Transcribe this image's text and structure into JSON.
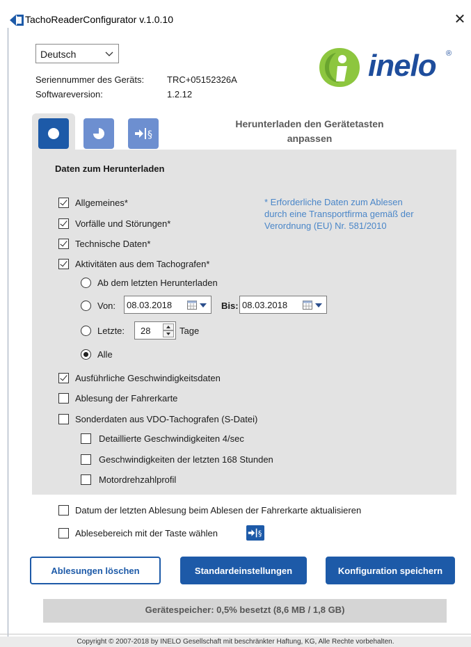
{
  "window": {
    "title": "TachoReaderConfigurator v.1.0.10",
    "close_glyph": "✕"
  },
  "language": {
    "selected": "Deutsch"
  },
  "device": {
    "serial_label": "Seriennummer des Geräts:",
    "serial_value": "TRC+05152326A",
    "software_label": "Softwareversion:",
    "software_value": "1.2.12"
  },
  "logo": {
    "text": "inelo",
    "reg": "®",
    "brand_color": "#1e4d9c",
    "accent_color": "#8dc63f"
  },
  "tabs": {
    "items": [
      {
        "icon": "circle-icon",
        "active": true
      },
      {
        "icon": "pie-chart-icon",
        "active": false
      },
      {
        "icon": "arrow-section-icon",
        "active": false
      }
    ],
    "caption_line1": "Herunterladen den Gerätetasten",
    "caption_line2": "anpassen"
  },
  "panel": {
    "title": "Daten zum Herunterladen",
    "note_line1": "* Erforderliche Daten zum Ablesen",
    "note_line2": "durch eine Transportfirma gemäß der",
    "note_line3": "Verordnung (EU) Nr. 581/2010",
    "options": {
      "allgemeines": {
        "label": "Allgemeines*",
        "checked": true
      },
      "vorfaelle": {
        "label": "Vorfälle und Störungen*",
        "checked": true
      },
      "technische": {
        "label": "Technische Daten*",
        "checked": true
      },
      "aktivitaeten": {
        "label": "Aktivitäten aus dem Tachografen*",
        "checked": true
      },
      "geschwindigkeit": {
        "label": "Ausführliche Geschwindigkeitsdaten",
        "checked": true
      },
      "fahrerkarte": {
        "label": "Ablesung der Fahrerkarte",
        "checked": false
      },
      "sonderdaten": {
        "label": "Sonderdaten aus VDO-Tachografen (S-Datei)",
        "checked": false
      },
      "detailliert": {
        "label": "Detaillierte Geschwindigkeiten 4/sec",
        "checked": false
      },
      "letzte168": {
        "label": "Geschwindigkeiten der letzten 168 Stunden",
        "checked": false
      },
      "motordrehzahl": {
        "label": "Motordrehzahlprofil",
        "checked": false
      }
    },
    "range": {
      "since_last": "Ab dem letzten Herunterladen",
      "von_label": "Von:",
      "von_value": "08.03.2018",
      "bis_label": "Bis:",
      "bis_value": "08.03.2018",
      "letzte_label": "Letzte:",
      "letzte_value": "28",
      "tage_label": "Tage",
      "alle_label": "Alle",
      "selected": "alle"
    }
  },
  "bottom_options": {
    "update_date": {
      "label": "Datum der letzten Ablesung beim Ablesen der Fahrerkarte aktualisieren",
      "checked": false
    },
    "range_key": {
      "label": "Ablesebereich mit der Taste wählen",
      "checked": false
    }
  },
  "buttons": {
    "clear": "Ablesungen löschen",
    "defaults": "Standardeinstellungen",
    "save": "Konfiguration speichern"
  },
  "storage": {
    "text": "Gerätespeicher: 0,5% besetzt (8,6 MB / 1,8 GB)"
  },
  "footer": {
    "text": "Copyright © 2007-2018 by INELO Gesellschaft mit beschränkter Haftung, KG, Alle Rechte vorbehalten."
  }
}
